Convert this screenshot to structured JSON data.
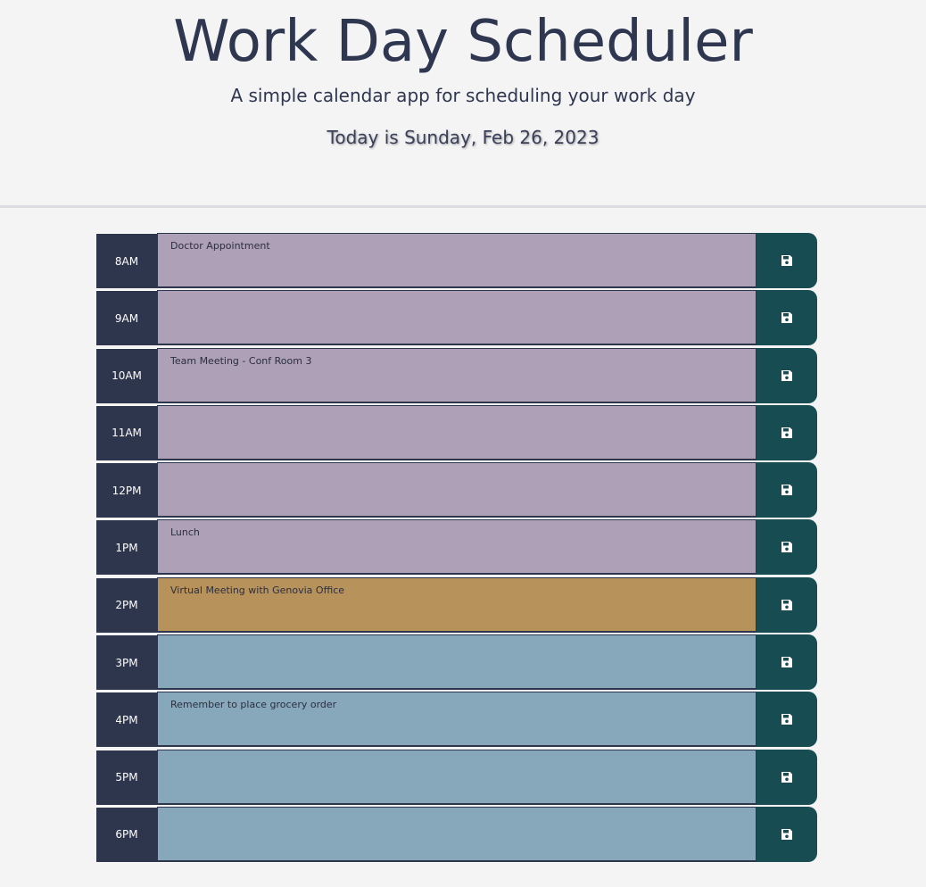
{
  "header": {
    "title": "Work Day Scheduler",
    "subtitle": "A simple calendar app for scheduling your work day",
    "current_day": "Today is Sunday, Feb 26, 2023"
  },
  "colors": {
    "past": "#ada0b7",
    "present": "#b7925b",
    "future": "#87a7bb",
    "hour_bg": "#2e364d",
    "save_bg": "#184c53"
  },
  "rows": [
    {
      "hour": "8AM",
      "text": "Doctor Appointment",
      "state": "past"
    },
    {
      "hour": "9AM",
      "text": "",
      "state": "past"
    },
    {
      "hour": "10AM",
      "text": "Team Meeting - Conf Room 3",
      "state": "past"
    },
    {
      "hour": "11AM",
      "text": "",
      "state": "past"
    },
    {
      "hour": "12PM",
      "text": "",
      "state": "past"
    },
    {
      "hour": "1PM",
      "text": "Lunch",
      "state": "past"
    },
    {
      "hour": "2PM",
      "text": "Virtual Meeting with Genovia Office",
      "state": "present"
    },
    {
      "hour": "3PM",
      "text": "",
      "state": "future"
    },
    {
      "hour": "4PM",
      "text": "Remember to place grocery order",
      "state": "future"
    },
    {
      "hour": "5PM",
      "text": "",
      "state": "future"
    },
    {
      "hour": "6PM",
      "text": "",
      "state": "future"
    }
  ],
  "icons": {
    "save": "floppy-disk-icon"
  }
}
